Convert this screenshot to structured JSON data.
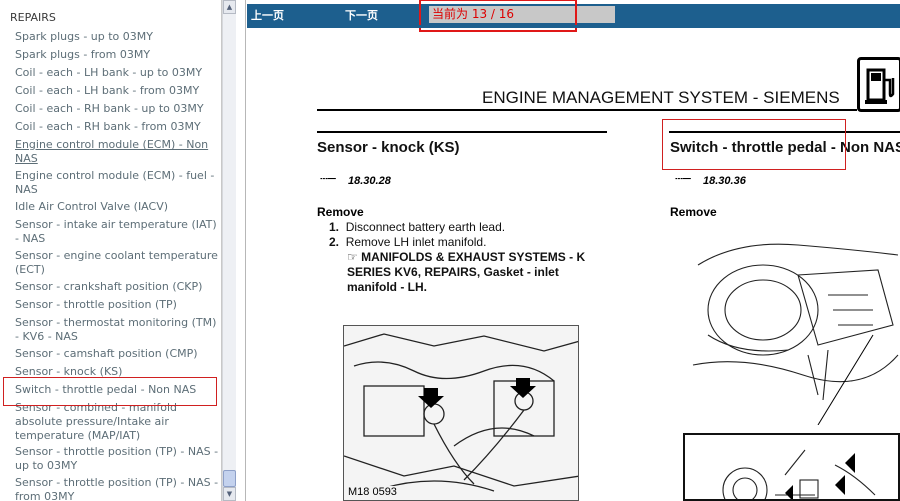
{
  "nav": {
    "section_title": "REPAIRS",
    "items": [
      {
        "label": "Spark plugs - up to 03MY"
      },
      {
        "label": "Spark plugs - from 03MY"
      },
      {
        "label": "Coil - each - LH bank - up to 03MY"
      },
      {
        "label": "Coil - each - LH bank - from 03MY"
      },
      {
        "label": "Coil - each - RH bank - up to 03MY"
      },
      {
        "label": "Coil - each - RH bank - from 03MY"
      },
      {
        "label": "Engine control module (ECM) - Non NAS"
      },
      {
        "label": "Engine control module (ECM) - fuel - NAS"
      },
      {
        "label": "Idle Air Control Valve (IACV)"
      },
      {
        "label": "Sensor - intake air temperature (IAT) - NAS"
      },
      {
        "label": "Sensor - engine coolant temperature (ECT)"
      },
      {
        "label": "Sensor - crankshaft position (CKP)"
      },
      {
        "label": "Sensor - throttle position (TP)"
      },
      {
        "label": "Sensor - thermostat monitoring (TM) - KV6 - NAS"
      },
      {
        "label": "Sensor - camshaft position (CMP)"
      },
      {
        "label": "Sensor - knock (KS)"
      },
      {
        "label": "Switch - throttle pedal - Non NAS"
      },
      {
        "label": "Sensor - combined - manifold absolute pressure/Intake air temperature (MAP/IAT)"
      },
      {
        "label": "Sensor - throttle position (TP) - NAS - up to 03MY"
      },
      {
        "label": "Sensor - throttle position (TP) - NAS - from 03MY"
      }
    ]
  },
  "toolbar": {
    "prev_label": "上一页",
    "next_label": "下一页",
    "page_indicator": "当前为  13 / 16"
  },
  "document": {
    "main_title": "ENGINE MANAGEMENT SYSTEM - SIEMENS",
    "left_section": {
      "title": "Sensor - knock (KS)",
      "ref": "18.30.28",
      "remove_label": "Remove",
      "steps": [
        "Disconnect battery earth lead.",
        "Remove LH inlet manifold."
      ],
      "see_text": "MANIFOLDS & EXHAUST SYSTEMS - K SERIES KV6, REPAIRS, Gasket - inlet manifold - LH.",
      "figure_code": "M18 0593"
    },
    "right_section": {
      "title": "Switch - throttle pedal - Non NAS",
      "ref": "18.30.36",
      "remove_label": "Remove"
    }
  },
  "colors": {
    "toolbar_bg": "#1d5f8e",
    "highlight_box": "#d02020",
    "nav_text": "#5d6e77"
  }
}
